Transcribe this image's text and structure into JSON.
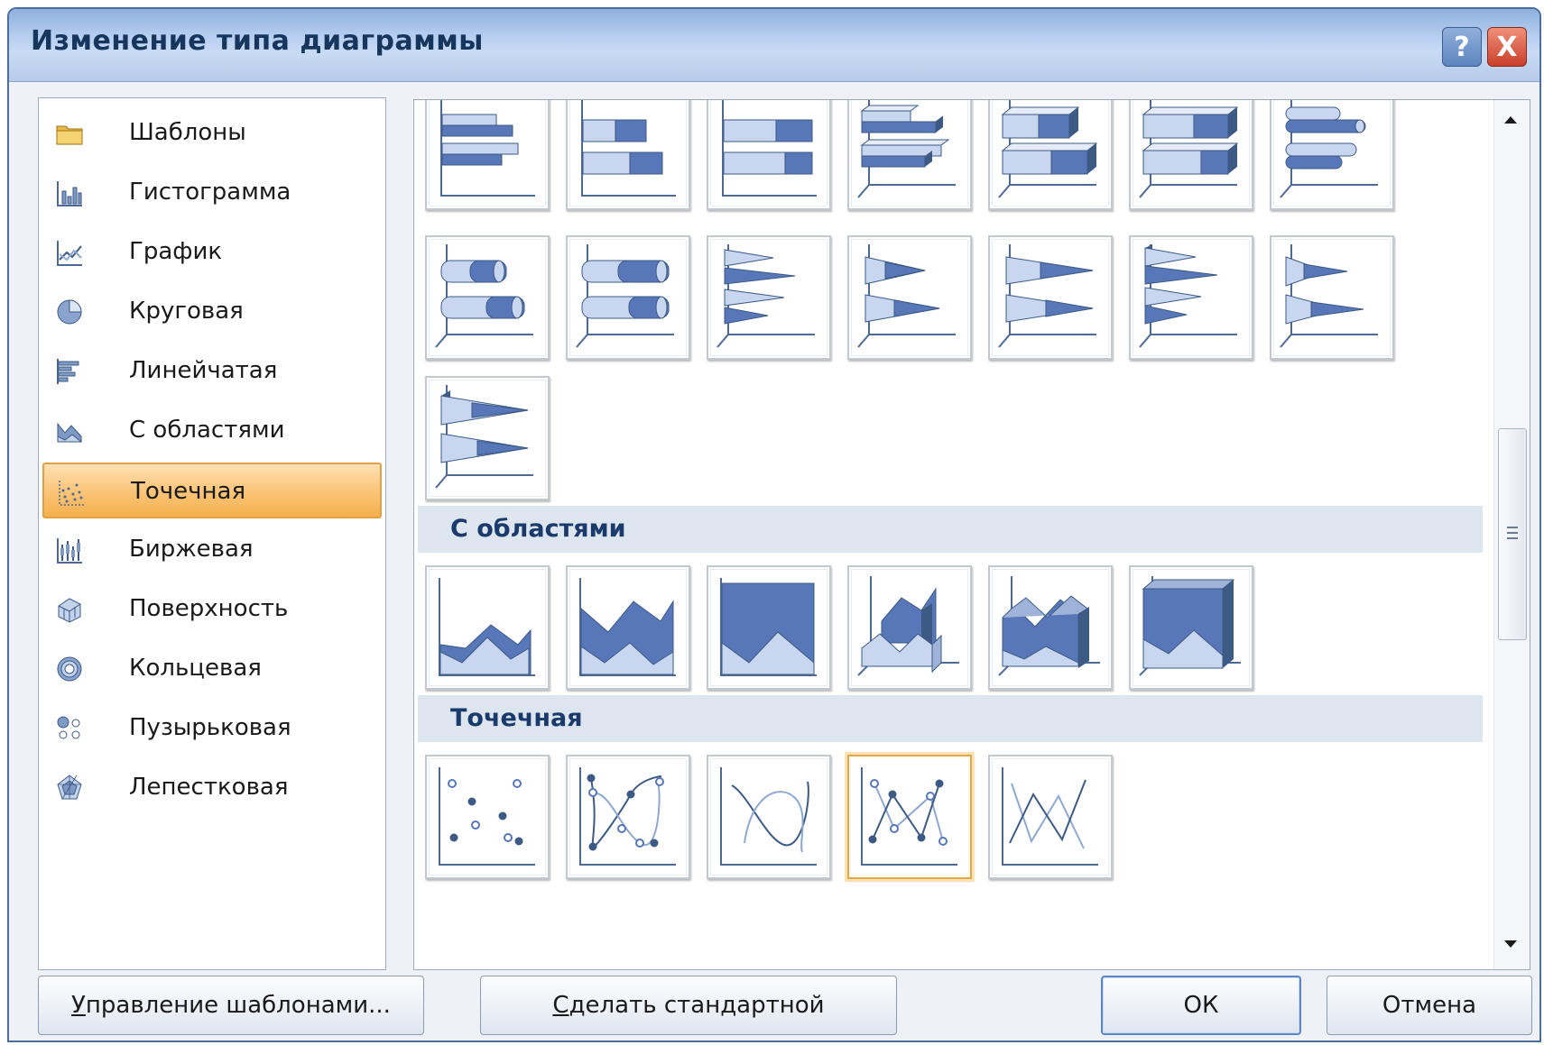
{
  "window": {
    "title": "Изменение типа диаграммы",
    "help_button": "?",
    "close_button": "X"
  },
  "categories": [
    {
      "label": "Шаблоны",
      "icon": "folder-icon"
    },
    {
      "label": "Гистограмма",
      "icon": "column-chart-icon"
    },
    {
      "label": "График",
      "icon": "line-chart-icon"
    },
    {
      "label": "Круговая",
      "icon": "pie-chart-icon"
    },
    {
      "label": "Линейчатая",
      "icon": "bar-chart-icon"
    },
    {
      "label": "С областями",
      "icon": "area-chart-icon"
    },
    {
      "label": "Точечная",
      "icon": "scatter-chart-icon",
      "selected": true
    },
    {
      "label": "Биржевая",
      "icon": "stock-chart-icon"
    },
    {
      "label": "Поверхность",
      "icon": "surface-chart-icon"
    },
    {
      "label": "Кольцевая",
      "icon": "doughnut-chart-icon"
    },
    {
      "label": "Пузырьковая",
      "icon": "bubble-chart-icon"
    },
    {
      "label": "Лепестковая",
      "icon": "radar-chart-icon"
    }
  ],
  "gallery": {
    "sections": [
      {
        "title": "С областями"
      },
      {
        "title": "Точечная"
      }
    ],
    "bar_thumbnails": [
      "clustered-bar-icon",
      "stacked-bar-icon",
      "100-stacked-bar-icon",
      "3d-clustered-bar-icon",
      "3d-stacked-bar-icon",
      "3d-100-stacked-bar-icon",
      "cylinder-clustered-bar-icon",
      "cylinder-stacked-bar-icon",
      "cylinder-100-stacked-bar-icon",
      "cone-clustered-bar-icon",
      "cone-stacked-bar-icon",
      "cone-100-stacked-bar-icon",
      "pyramid-clustered-bar-icon",
      "pyramid-stacked-bar-icon",
      "pyramid-100-stacked-bar-icon"
    ],
    "area_thumbnails": [
      "area-icon",
      "stacked-area-icon",
      "100-stacked-area-icon",
      "3d-area-icon",
      "3d-stacked-area-icon",
      "3d-100-stacked-area-icon"
    ],
    "scatter_thumbnails": [
      "scatter-markers-icon",
      "scatter-smooth-markers-icon",
      "scatter-smooth-lines-icon",
      "scatter-straight-markers-icon",
      "scatter-straight-lines-icon"
    ],
    "selected_scatter": "scatter-straight-markers-icon"
  },
  "buttons": {
    "manage_templates": {
      "mnemonic": "У",
      "rest": "правление шаблонами..."
    },
    "set_default": {
      "mnemonic": "С",
      "rest": "делать стандартной"
    },
    "ok": "ОК",
    "cancel": "Отмена"
  },
  "colors": {
    "titlebar": "#b8cff0",
    "title_text": "#17365d",
    "selection": "#fbc880",
    "chart_fill_dark": "#5877b8",
    "chart_fill_light": "#c8d7ef",
    "section_header": "#dde5ef"
  }
}
